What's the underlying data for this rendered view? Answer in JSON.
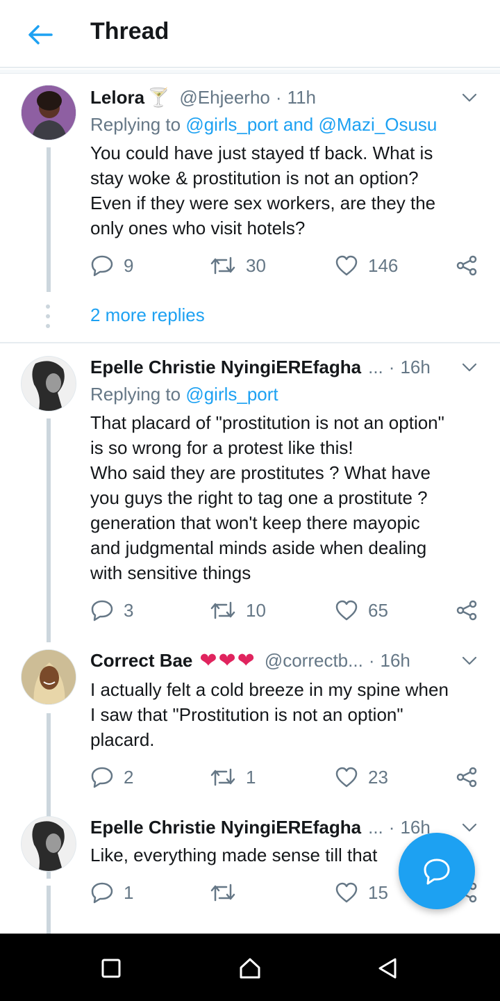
{
  "header": {
    "title": "Thread",
    "back_icon": "arrow-left-icon",
    "accent": "#1da1f2"
  },
  "tweets": [
    {
      "name": "Lelora",
      "name_emoji": "🍸",
      "handle": "@Ehjeerho",
      "dot": "·",
      "time": "11h",
      "reply_prefix": "Replying to ",
      "reply_mentions": "@girls_port and @Mazi_Osusu",
      "text": "You could have just stayed tf back. What is\nstay woke & prostitution is not an option?\nEven if they were sex workers, are they the\nonly ones who visit hotels?",
      "replies": "9",
      "retweets": "30",
      "likes": "146"
    },
    {
      "name": "Epelle Christie NyingiEREfagha",
      "handle": "...",
      "dot": "·",
      "time": "16h",
      "reply_prefix": "Replying to ",
      "reply_mentions": "@girls_port",
      "text": "That placard of \"prostitution is not an option\"\nis so wrong for a protest like this!\nWho said they are prostitutes ? What have\nyou guys the right to tag one a  prostitute ?\ngeneration  that won't keep  there mayopic\nand judgmental minds aside when dealing\nwith sensitive things",
      "replies": "3",
      "retweets": "10",
      "likes": "65"
    },
    {
      "name": "Correct Bae",
      "name_emoji": "❤❤❤",
      "handle": "@correctb...",
      "dot": "·",
      "time": "16h",
      "text": "I actually felt a cold breeze in my spine when\nI saw that \"Prostitution is not an option\"\nplacard.",
      "replies": "2",
      "retweets": "1",
      "likes": "23"
    },
    {
      "name": "Epelle Christie NyingiEREfagha",
      "handle": "...",
      "dot": "·",
      "time": "16h",
      "text": "Like, everything made sense till that",
      "replies": "1",
      "retweets": "",
      "likes": "15"
    }
  ],
  "more_replies": "2 more replies",
  "fab_icon": "compose-reply-icon",
  "navbar": {
    "icons": [
      "recents-square-icon",
      "home-icon",
      "back-triangle-icon"
    ]
  }
}
